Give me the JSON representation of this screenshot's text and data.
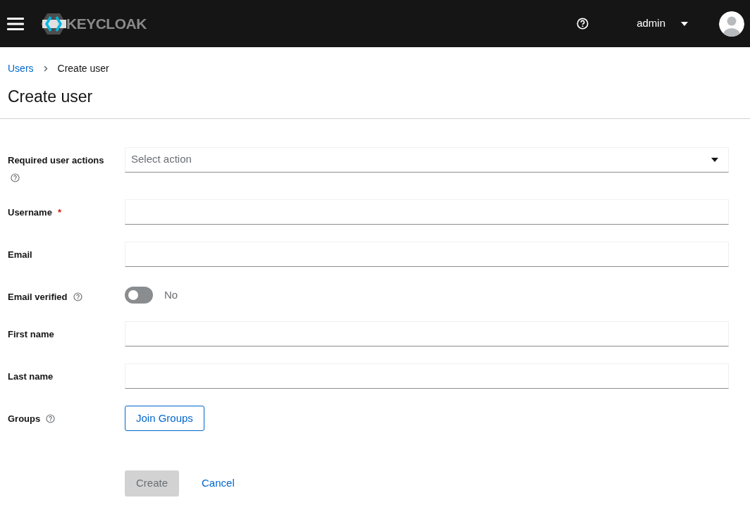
{
  "header": {
    "logo_text": "KEYCLOAK",
    "user": "admin"
  },
  "breadcrumb": [
    {
      "label": "Users",
      "link": true
    },
    {
      "label": "Create user",
      "link": false
    }
  ],
  "title": "Create user",
  "fields": [
    {
      "kind": "select",
      "label": "Required user actions",
      "help": true,
      "placeholder": "Select action"
    },
    {
      "kind": "text",
      "label": "Username",
      "help": false,
      "required_mark": "*"
    },
    {
      "kind": "text",
      "label": "Email",
      "help": false
    },
    {
      "kind": "switch",
      "label": "Email verified",
      "help": true,
      "on": false,
      "value_label": "No"
    },
    {
      "kind": "text",
      "label": "First name",
      "help": false
    },
    {
      "kind": "text",
      "label": "Last name",
      "help": false
    },
    {
      "kind": "button",
      "label": "Groups",
      "help": true,
      "button": "Join Groups"
    }
  ],
  "actions": [
    {
      "label": "Create",
      "kind": "primary",
      "disabled": true
    },
    {
      "label": "Cancel",
      "kind": "link",
      "disabled": false
    }
  ]
}
